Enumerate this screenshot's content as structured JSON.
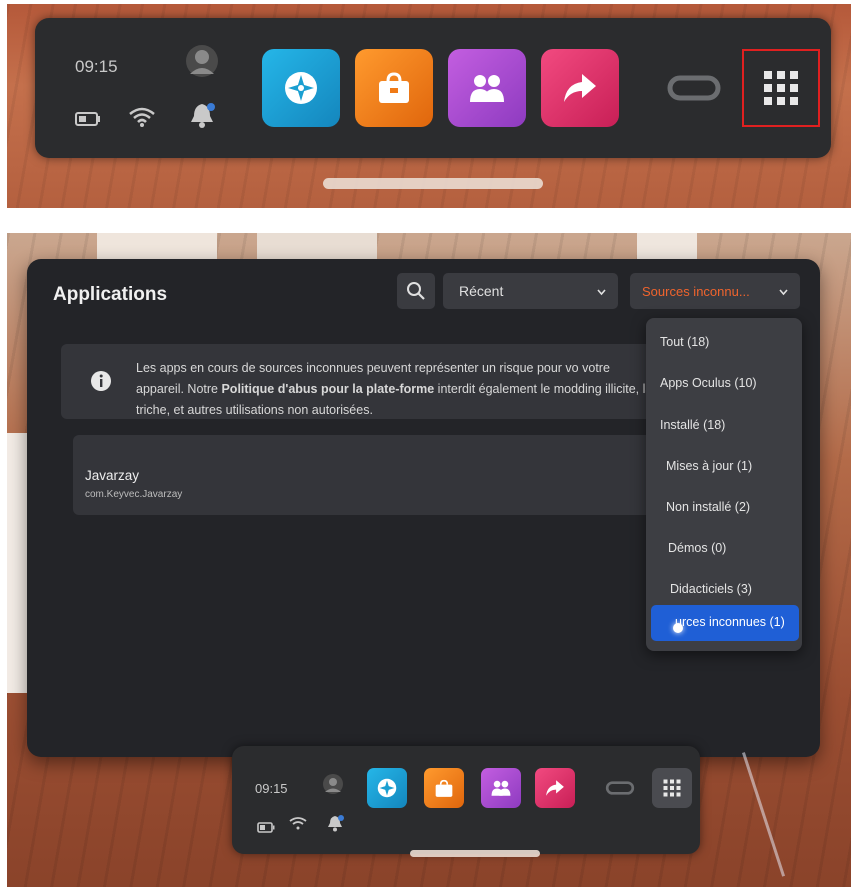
{
  "dock": {
    "time": "09:15",
    "icons": [
      {
        "name": "explore-icon",
        "color": "#1a9fd1"
      },
      {
        "name": "store-icon",
        "color": "#f07a16"
      },
      {
        "name": "people-icon",
        "color": "#b04fd0"
      },
      {
        "name": "share-icon",
        "color": "#e0306a"
      },
      {
        "name": "oculus-icon"
      },
      {
        "name": "app-library-icon"
      }
    ],
    "highlight_color": "#e02020"
  },
  "app_window": {
    "title": "Applications",
    "sort_select": {
      "value": "Récent"
    },
    "filter_select": {
      "value": "Sources inconnu..."
    },
    "banner": {
      "text_before": "Les apps en cours de sources inconnues peuvent représenter un risque pour vo votre appareil. Notre ",
      "bold": "Politique d'abus pour la plate-forme",
      "text_after": " interdit également le modding illicite, la triche, et autres utilisations non autorisées."
    },
    "app": {
      "name": "Javarzay",
      "package": "com.Keyvec.Javarzay"
    },
    "menu": {
      "items": [
        "Tout (18)",
        "Apps Oculus (10)",
        "Installé (18)",
        "Mises à jour (1)",
        "Non installé (2)",
        "Démos (0)",
        "Didacticiels (3)",
        "urces inconnues (1)"
      ],
      "selected_color": "#1f5fd6"
    }
  }
}
